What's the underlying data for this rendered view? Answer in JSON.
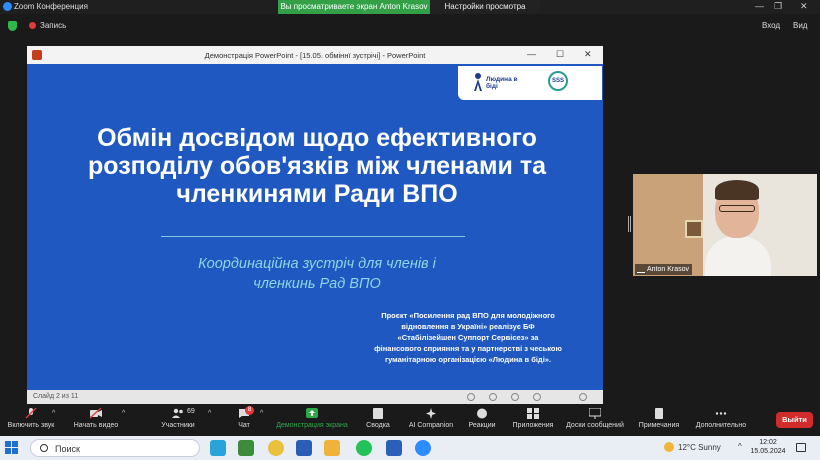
{
  "zoom_window": {
    "title": "Zoom Конференция",
    "share_banner": "Вы просматриваете экран Anton Krasov",
    "view_options": "Настройки просмотра",
    "recording_label": "Запись",
    "view_button": "Вход",
    "exit_fullscreen": "Вид"
  },
  "ppt_window": {
    "title": "Демонстрація PowerPoint - [15.05. обміннї зустрічі] - PowerPoint",
    "status_slide": "Слайд 2 из 11"
  },
  "slide": {
    "logo_text": "Людина в біді",
    "sss_logo": "SSS",
    "title_lines": [
      "Обмін досвідом щодо ефективного",
      "розподілу обов'язків між членами та",
      "членкинями Ради ВПО"
    ],
    "subtitle_lines": [
      "Координаційна зустріч для членів і",
      "членкинь Рад ВПО"
    ],
    "project_text": "Проєкт «Посилення рад ВПО для молодіжного відновлення в Україні» реалізує БФ «Стабілізейшен Суппорт Сервісез» за фінансового сприяння та у партнерстві з чеською гуманітарною організацією «Людина в біді»."
  },
  "video": {
    "participant_name": "Anton Krasov"
  },
  "toolbar": {
    "audio": "Включить звук",
    "video": "Начать видео",
    "participants": "Участники",
    "participants_count": "69",
    "chat": "Чат",
    "chat_badge": "8",
    "share": "Демонстрация экрана",
    "summary": "Сводка",
    "ai": "AI Companion",
    "reactions": "Реакции",
    "apps": "Приложения",
    "whiteboards": "Доски сообщений",
    "notes": "Примечания",
    "more": "Дополнительно",
    "leave": "Выйти"
  },
  "taskbar": {
    "search": "Поиск",
    "weather": "12°C  Sunny",
    "time": "12:02",
    "date": "15.05.2024"
  },
  "colors": {
    "slide_bg": "#1f58c0",
    "subtitle": "#8fd6e6",
    "share_green": "#2fa84a",
    "leave_red": "#d12b2b"
  }
}
